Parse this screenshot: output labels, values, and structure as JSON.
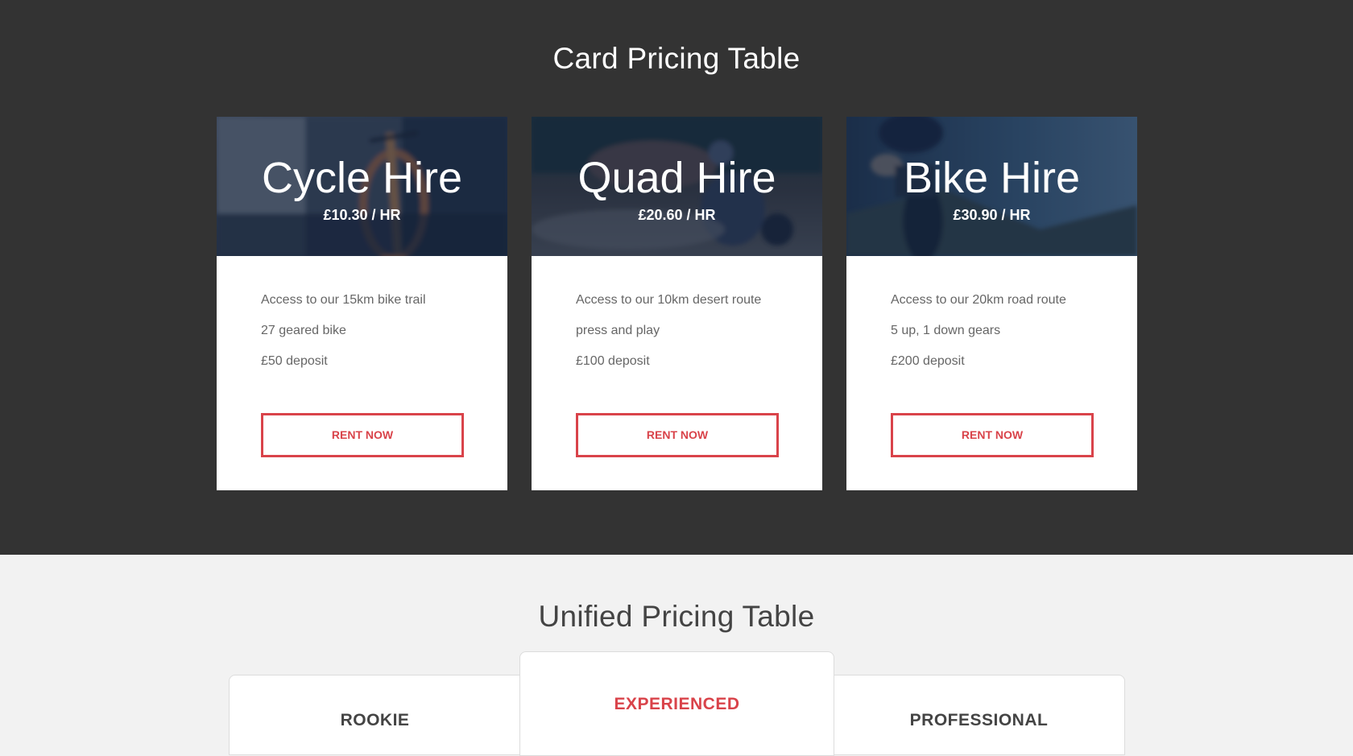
{
  "card_section": {
    "title": "Card Pricing Table",
    "cards": [
      {
        "name": "Cycle Hire",
        "price": "£10.30 / HR",
        "features": [
          "Access to our 15km bike trail",
          "27 geared bike",
          "£50 deposit"
        ],
        "button": "RENT NOW"
      },
      {
        "name": "Quad Hire",
        "price": "£20.60 / HR",
        "features": [
          "Access to our 10km desert route",
          "press and play",
          "£100 deposit"
        ],
        "button": "RENT NOW"
      },
      {
        "name": "Bike Hire",
        "price": "£30.90 / HR",
        "features": [
          "Access to our 20km road route",
          "5 up, 1 down gears",
          "£200 deposit"
        ],
        "button": "RENT NOW"
      }
    ]
  },
  "unified_section": {
    "title": "Unified Pricing Table",
    "plans": [
      {
        "name": "ROOKIE"
      },
      {
        "name": "EXPERIENCED"
      },
      {
        "name": "PROFESSIONAL"
      }
    ]
  },
  "colors": {
    "dark_bg": "#333333",
    "light_bg": "#f2f2f2",
    "accent": "#d9434a",
    "text_muted": "#666666"
  }
}
